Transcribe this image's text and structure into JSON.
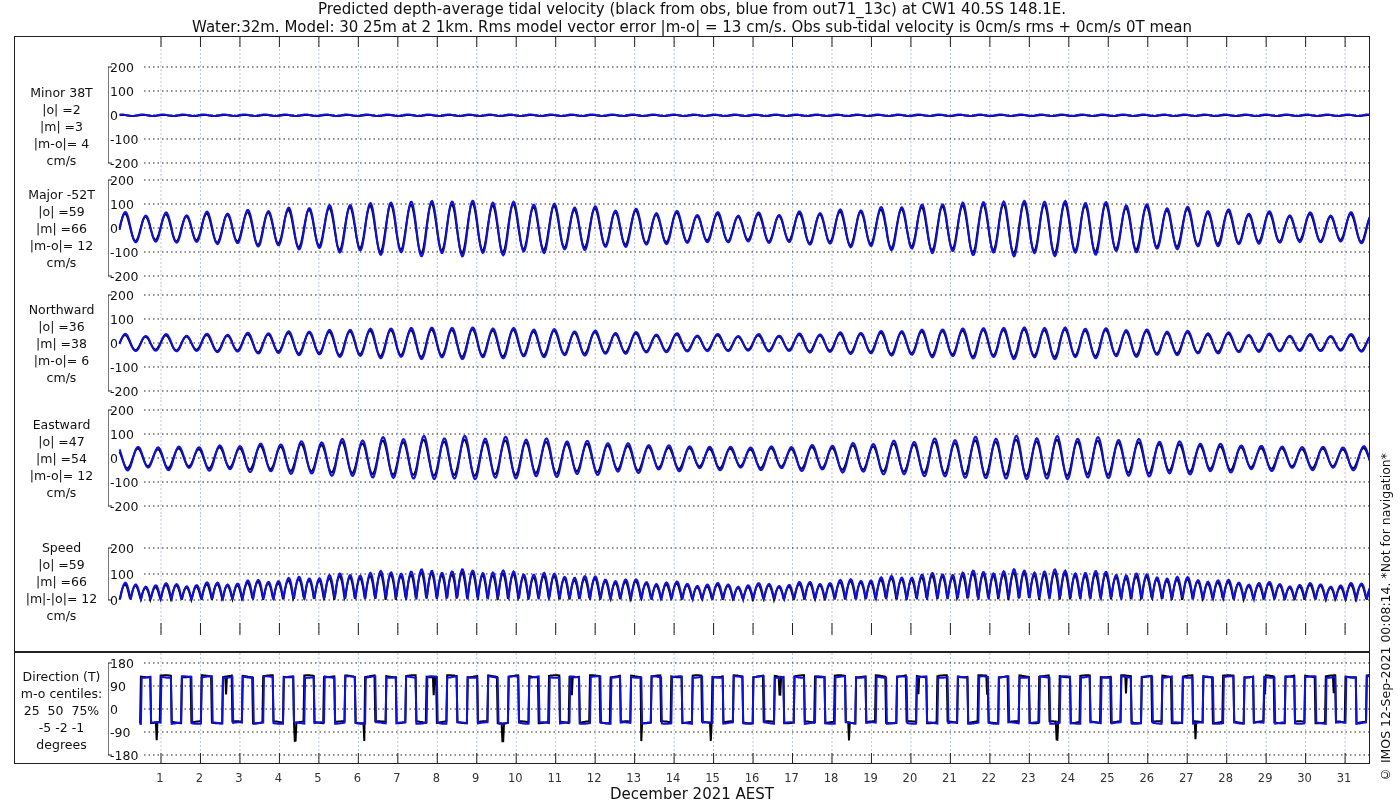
{
  "title": [
    "Predicted depth-average tidal velocity (black from obs, blue from out71_13c) at CW1 40.5S 148.1E.",
    "Water:32m. Model: 30 25m at 2 1km. Rms model vector error |m-o| = 13 cm/s. Obs sub-tidal velocity is 0cm/s rms + 0cm/s 0T mean"
  ],
  "panels": [
    {
      "kind": "minor",
      "label": [
        "Minor 38T",
        "|o| =2",
        "|m| =3",
        "|m-o|= 4",
        "cm/s"
      ],
      "yticks": [
        "200",
        "100",
        "0",
        "-100",
        "-200"
      ]
    },
    {
      "kind": "major",
      "label": [
        "Major -52T",
        "|o| =59",
        "|m| =66",
        "|m-o|= 12",
        "cm/s"
      ],
      "yticks": [
        "200",
        "100",
        "0",
        "-100",
        "-200"
      ]
    },
    {
      "kind": "northward",
      "label": [
        "Northward",
        "|o| =36",
        "|m| =38",
        "|m-o|= 6",
        "cm/s"
      ],
      "yticks": [
        "200",
        "100",
        "0",
        "-100",
        "-200"
      ]
    },
    {
      "kind": "eastward",
      "label": [
        "Eastward",
        "|o| =47",
        "|m| =54",
        "|m-o|= 12",
        "cm/s"
      ],
      "yticks": [
        "200",
        "100",
        "0",
        "-100",
        "-200"
      ]
    },
    {
      "kind": "speed",
      "label": [
        "Speed",
        "|o| =59",
        "|m| =66",
        "|m|-|o|= 12",
        "cm/s"
      ],
      "yticks": [
        "200",
        "100",
        "0"
      ]
    },
    {
      "kind": "direction",
      "label": [
        "Direction (T)",
        "m-o centiles:",
        "25  50  75%",
        "-5 -2 -1",
        "degrees"
      ],
      "yticks": [
        "180",
        "90",
        "0",
        "-90",
        "-180"
      ]
    }
  ],
  "xticks": [
    "1",
    "2",
    "3",
    "4",
    "5",
    "6",
    "7",
    "8",
    "9",
    "10",
    "11",
    "12",
    "13",
    "14",
    "15",
    "16",
    "17",
    "18",
    "19",
    "20",
    "21",
    "22",
    "23",
    "24",
    "25",
    "26",
    "27",
    "28",
    "29",
    "30",
    "31"
  ],
  "xlabel": "December 2021 AEST",
  "footer_note": "© IMOS 12-Sep-2021 00:08:14. *Not for navigation*"
}
